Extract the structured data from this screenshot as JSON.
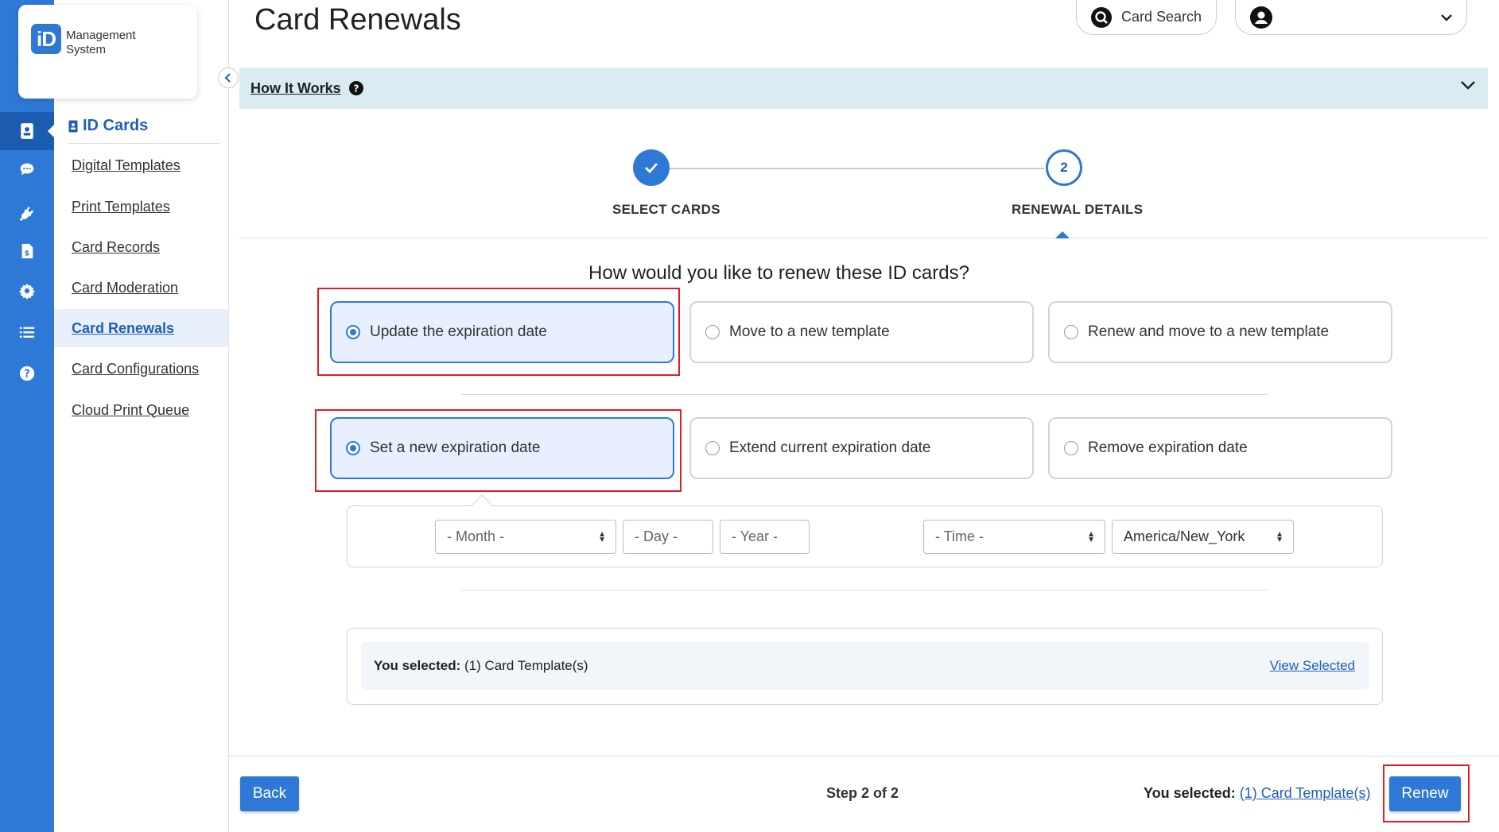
{
  "app": {
    "logo_mark": "iD",
    "logo_text_1": "Management",
    "logo_text_2": "System"
  },
  "rail": {
    "items": [
      {
        "icon": "id-card-icon",
        "active": true
      },
      {
        "icon": "chat-icon",
        "active": false
      },
      {
        "icon": "integrations-icon",
        "active": false
      },
      {
        "icon": "billing-icon",
        "active": false
      },
      {
        "icon": "settings-gear-icon",
        "active": false
      },
      {
        "icon": "list-icon",
        "active": false
      },
      {
        "icon": "help-icon",
        "active": false
      }
    ]
  },
  "sidebar": {
    "heading": "ID Cards",
    "items": [
      {
        "label": "Digital Templates"
      },
      {
        "label": "Print Templates"
      },
      {
        "label": "Card Records"
      },
      {
        "label": "Card Moderation"
      },
      {
        "label": "Card Renewals",
        "active": true
      },
      {
        "label": "Card Configurations"
      },
      {
        "label": "Cloud Print Queue"
      }
    ]
  },
  "header": {
    "title": "Card Renewals",
    "card_search": "Card Search",
    "user_name": ""
  },
  "how_it_works": {
    "label": "How It Works"
  },
  "stepper": {
    "step1_label": "SELECT CARDS",
    "step2_number": "2",
    "step2_label": "RENEWAL DETAILS"
  },
  "question": "How would you like to renew these ID cards?",
  "renew_options": [
    {
      "label": "Update the expiration date",
      "selected": true
    },
    {
      "label": "Move to a new template",
      "selected": false
    },
    {
      "label": "Renew and move to a new template",
      "selected": false
    }
  ],
  "expiration_options": [
    {
      "label": "Set a new expiration date",
      "selected": true
    },
    {
      "label": "Extend current expiration date",
      "selected": false
    },
    {
      "label": "Remove expiration date",
      "selected": false
    }
  ],
  "date_fields": {
    "month": "- Month -",
    "day": "- Day -",
    "year": "- Year -",
    "time": "- Time -",
    "timezone": "America/New_York"
  },
  "selected_panel": {
    "prefix": "You selected:",
    "value": "(1) Card Template(s)",
    "view_link": "View Selected"
  },
  "footer": {
    "back": "Back",
    "step_of": "Step 2 of 2",
    "selected_prefix": "You selected:",
    "selected_link": "(1) Card Template(s)",
    "renew": "Renew"
  },
  "colors": {
    "primary": "#2f79d6",
    "highlight": "#e21c23",
    "info_bar": "#d8ecf1"
  }
}
